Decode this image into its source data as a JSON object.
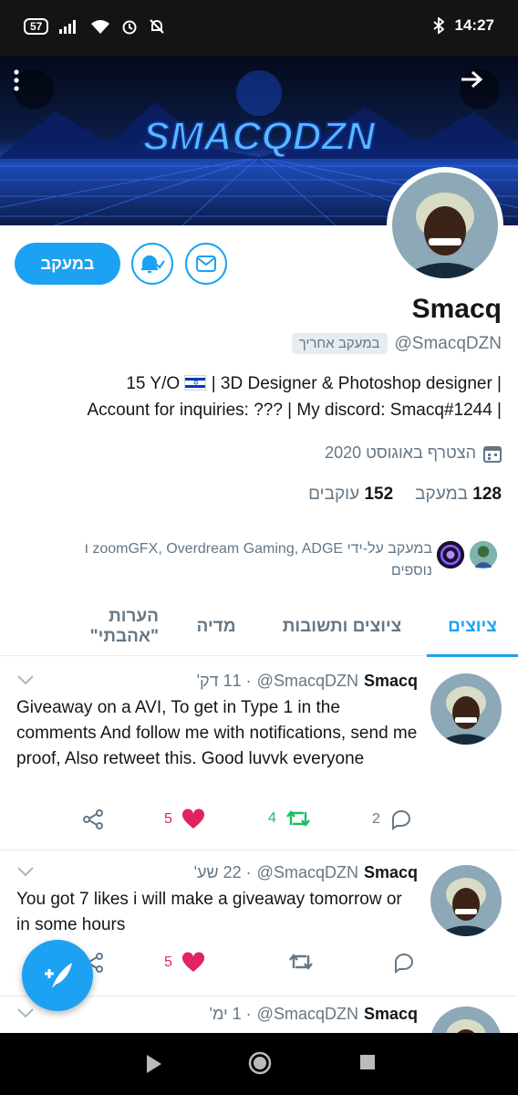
{
  "statusbar": {
    "notif_count": "57",
    "time": "14:27"
  },
  "profile": {
    "name": "Smacq",
    "handle": "@SmacqDZN",
    "follows_you": "במעקב אחריך",
    "follow_button": "במעקב",
    "bio_line1_pre": "15 Y/O",
    "bio_line1_post": "| 3D Designer & Photoshop designer |",
    "bio_line2": "Account for inquiries: ??? | My discord: Smacq#1244 |",
    "joined": "הצטרף באוגוסט 2020",
    "following_count": "128",
    "following_label": "במעקב",
    "followers_count": "152",
    "followers_label": "עוקבים",
    "followed_by_line1": "במעקב על-ידי zoomGFX, Overdream Gaming, ADGE ו",
    "followed_by_line2": "נוספים",
    "banner_logo": "SMACQDZN"
  },
  "tabs": [
    {
      "label": "ציוצים",
      "active": true
    },
    {
      "label": "ציוצים ותשובות",
      "active": false
    },
    {
      "label": "מדיה",
      "active": false
    },
    {
      "label": "הערות \"אהבתי\"",
      "active": false
    }
  ],
  "tweets": [
    {
      "name": "Smacq",
      "handle": "@SmacqDZN",
      "time": "· 11 דק'",
      "text": "Giveaway on a AVI, To get in Type 1 in the comments And follow me with notifications, send me proof, Also retweet this. Good luvvk everyone",
      "replies": "2",
      "retweets": "4",
      "likes": "5"
    },
    {
      "name": "Smacq",
      "handle": "@SmacqDZN",
      "time": "· 22 שע'",
      "text": "You got 7 likes i will make a giveaway tomorrow or in some hours",
      "replies": "",
      "retweets": "",
      "likes": "5"
    },
    {
      "name": "Smacq",
      "handle": "@SmacqDZN",
      "time": "· 1 ימ'",
      "text": ""
    }
  ],
  "colors": {
    "accent": "#1da1f2",
    "like": "#e0245e",
    "retweet": "#17bf63",
    "muted": "#657786"
  }
}
